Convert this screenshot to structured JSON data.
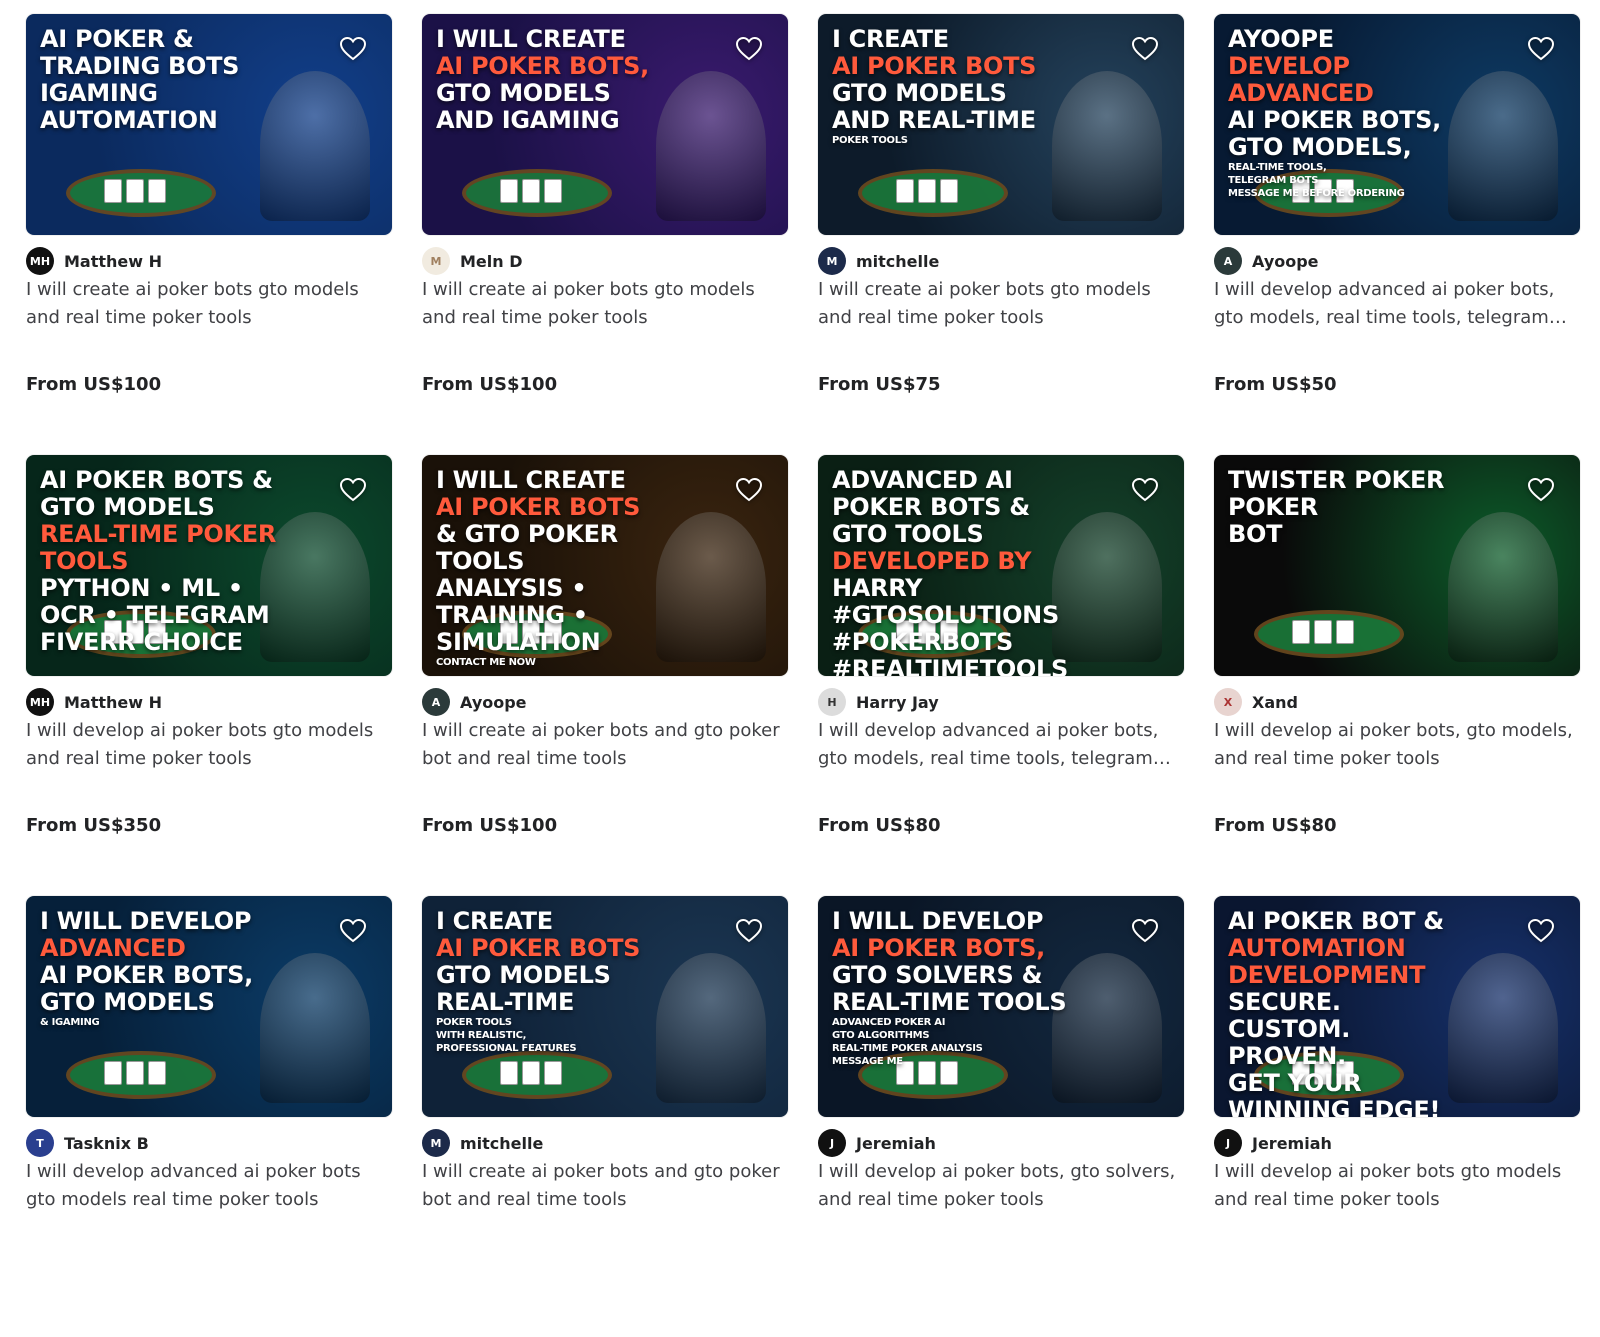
{
  "gigs": [
    {
      "thumb_lines": [
        "AI POKER & TRADING BOTS",
        "iGAMING AUTOMATION"
      ],
      "seller": "Matthew H",
      "title": "I will create ai poker bots gto models and real time poker tools",
      "price": "From US$100",
      "colors": [
        "#0b2a5e",
        "#123f8a"
      ]
    },
    {
      "thumb_lines": [
        "I WILL CREATE",
        "AI POKER BOTS,",
        "GTO MODELS",
        "AND iGAMING"
      ],
      "seller": "Meln D",
      "title": "I will create ai poker bots gto models and real time poker tools",
      "price": "From US$100",
      "colors": [
        "#1b1147",
        "#3a1a6e"
      ]
    },
    {
      "thumb_lines": [
        "I CREATE",
        "AI POKER BOTS",
        "GTO MODELS",
        "AND REAL-TIME",
        "POKER TOOLS"
      ],
      "seller": "mitchelle",
      "title": "I will create ai poker bots gto models and real time poker tools",
      "price": "From US$75",
      "colors": [
        "#0d1b2a",
        "#24425c"
      ]
    },
    {
      "thumb_lines": [
        "AYOOPE",
        "Develop Advanced",
        "AI Poker Bots,",
        "GTO Models,",
        "Real-Time Tools,",
        "Telegram Bots",
        "Message me before ordering"
      ],
      "seller": "Ayoope",
      "title": "I will develop advanced ai poker bots, gto models, real time tools, telegram bots",
      "price": "From US$50",
      "colors": [
        "#071a33",
        "#0e3a63"
      ]
    },
    {
      "thumb_lines": [
        "AI POKER BOTS & GTO MODELS",
        "REAL-TIME POKER TOOLS",
        "PYTHON • ML • OCR • TELEGRAM",
        "Fiverr Choice"
      ],
      "seller": "Matthew H",
      "title": "I will develop ai poker bots gto models and real time poker tools",
      "price": "From US$350",
      "colors": [
        "#06261a",
        "#0c4a2d"
      ]
    },
    {
      "thumb_lines": [
        "I WILL CREATE",
        "AI Poker Bots",
        "& GTO Poker Tools",
        "ANALYSIS • TRAINING • SIMULATION",
        "CONTACT ME NOW"
      ],
      "seller": "Ayoope",
      "title": "I will create ai poker bots and gto poker bot and real time tools",
      "price": "From US$100",
      "colors": [
        "#1a1108",
        "#3a240f"
      ]
    },
    {
      "thumb_lines": [
        "ADVANCED AI POKER BOTS & GTO TOOLS",
        "DEVELOPED BY",
        "HARRY",
        "#GTOsolutions #PokerBots #RealTimeTools #TelegramBots #AIpoker"
      ],
      "seller": "Harry Jay",
      "title": "I will develop advanced ai poker bots, gto models, real time tools, telegram bots",
      "price": "From US$80",
      "colors": [
        "#0a1f14",
        "#14412a"
      ]
    },
    {
      "thumb_lines": [
        "Twister Poker",
        "POKER",
        "BOT"
      ],
      "seller": "Xand",
      "title": "I will develop ai poker bots, gto models, and real time poker tools",
      "price": "From US$80",
      "colors": [
        "#0a0a0a",
        "#0d5c2a"
      ]
    },
    {
      "thumb_lines": [
        "I WILL DEVELOP",
        "ADVANCED",
        "AI POKER BOTS,",
        "GTO MODELS",
        "& iGAMING"
      ],
      "seller": "Tasknix B",
      "title": "I will develop advanced ai poker bots gto models real time poker tools",
      "price": "",
      "colors": [
        "#06203a",
        "#0b3b66"
      ]
    },
    {
      "thumb_lines": [
        "I CREATE",
        "AI POKER BOTS",
        "GTO MODELS",
        "REAL-TIME",
        "POKER TOOLS",
        "WITH REALISTIC,",
        "PROFESSIONAL FEATURES"
      ],
      "seller": "mitchelle",
      "title": "I will create ai poker bots and gto poker bot and real time tools",
      "price": "",
      "colors": [
        "#0f2238",
        "#1b3652"
      ]
    },
    {
      "thumb_lines": [
        "I WILL DEVELOP",
        "AI POKER BOTS,",
        "GTO SOLVERS &",
        "REAL-TIME TOOLS",
        "Advanced Poker AI",
        "GTO Algorithms",
        "Real-Time Poker Analysis",
        "MESSAGE ME"
      ],
      "seller": "Jeremiah",
      "title": "I will develop ai poker bots, gto solvers, and real time poker tools",
      "price": "",
      "colors": [
        "#0a1626",
        "#13283f"
      ]
    },
    {
      "thumb_lines": [
        "AI POKER BOT &",
        "AUTOMATION DEVELOPMENT",
        "SECURE. CUSTOM. PROVEN.",
        "GET YOUR WINNING EDGE!"
      ],
      "seller": "Jeremiah",
      "title": "I will develop ai poker bots gto models and real time poker tools",
      "price": "",
      "colors": [
        "#0a1630",
        "#16306a"
      ]
    }
  ],
  "icons": {
    "favorite": "heart-outline-icon"
  }
}
